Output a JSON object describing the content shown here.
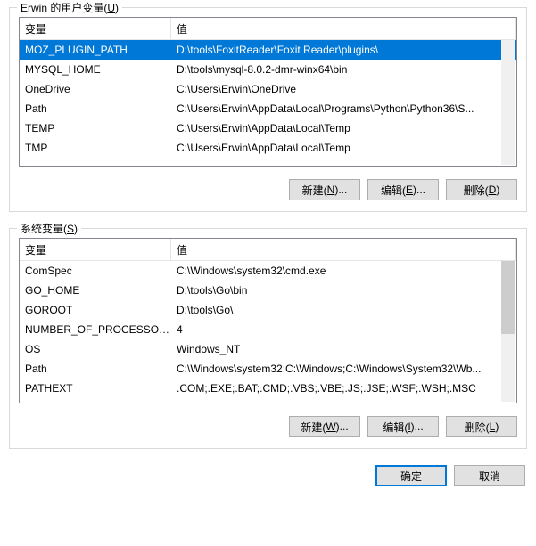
{
  "user_group_title_prefix": "Erwin 的用户变量(",
  "user_group_title_key": "U",
  "user_group_title_suffix": ")",
  "sys_group_title_prefix": "系统变量(",
  "sys_group_title_key": "S",
  "sys_group_title_suffix": ")",
  "columns": {
    "name": "变量",
    "value": "值"
  },
  "user_vars": [
    {
      "name": "MOZ_PLUGIN_PATH",
      "value": "D:\\tools\\FoxitReader\\Foxit Reader\\plugins\\",
      "selected": true
    },
    {
      "name": "MYSQL_HOME",
      "value": "D:\\tools\\mysql-8.0.2-dmr-winx64\\bin"
    },
    {
      "name": "OneDrive",
      "value": "C:\\Users\\Erwin\\OneDrive"
    },
    {
      "name": "Path",
      "value": "C:\\Users\\Erwin\\AppData\\Local\\Programs\\Python\\Python36\\S..."
    },
    {
      "name": "TEMP",
      "value": "C:\\Users\\Erwin\\AppData\\Local\\Temp"
    },
    {
      "name": "TMP",
      "value": "C:\\Users\\Erwin\\AppData\\Local\\Temp"
    }
  ],
  "sys_vars": [
    {
      "name": "ComSpec",
      "value": "C:\\Windows\\system32\\cmd.exe"
    },
    {
      "name": "GO_HOME",
      "value": "D:\\tools\\Go\\bin"
    },
    {
      "name": "GOROOT",
      "value": "D:\\tools\\Go\\"
    },
    {
      "name": "NUMBER_OF_PROCESSORS",
      "value": "4"
    },
    {
      "name": "OS",
      "value": "Windows_NT"
    },
    {
      "name": "Path",
      "value": "C:\\Windows\\system32;C:\\Windows;C:\\Windows\\System32\\Wb..."
    },
    {
      "name": "PATHEXT",
      "value": ".COM;.EXE;.BAT;.CMD;.VBS;.VBE;.JS;.JSE;.WSF;.WSH;.MSC"
    }
  ],
  "buttons": {
    "new_n_pre": "新建(",
    "new_n_key": "N",
    "new_n_suf": ")...",
    "edit_e_pre": "编辑(",
    "edit_e_key": "E",
    "edit_e_suf": ")...",
    "del_d_pre": "删除(",
    "del_d_key": "D",
    "del_d_suf": ")",
    "new_w_pre": "新建(",
    "new_w_key": "W",
    "new_w_suf": ")...",
    "edit_i_pre": "编辑(",
    "edit_i_key": "I",
    "edit_i_suf": ")...",
    "del_l_pre": "删除(",
    "del_l_key": "L",
    "del_l_suf": ")",
    "ok": "确定",
    "cancel": "取消"
  }
}
